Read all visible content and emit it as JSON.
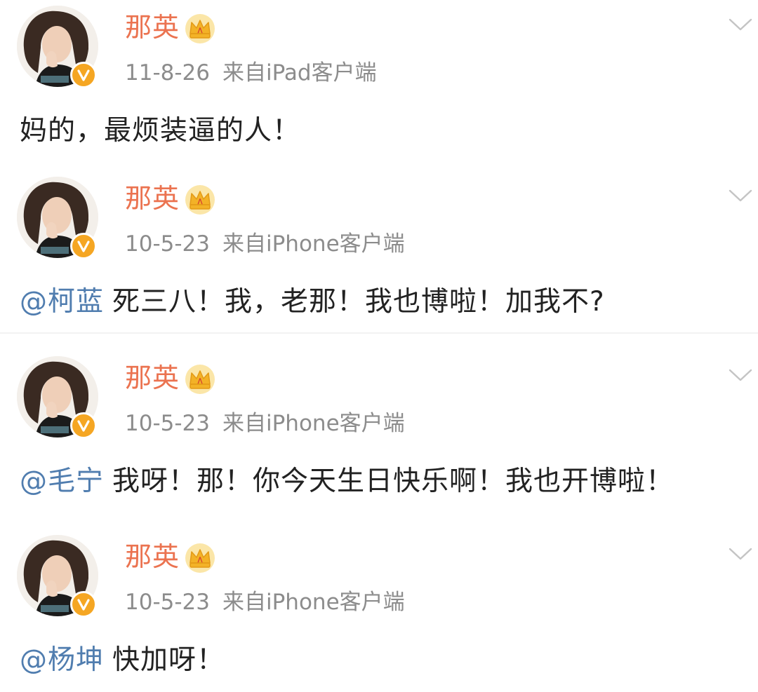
{
  "posts": [
    {
      "username": "那英",
      "time": "11-8-26",
      "source": "来自iPad客户端",
      "mention": "",
      "text": "妈的，最烦装逼的人！"
    },
    {
      "username": "那英",
      "time": "10-5-23",
      "source": "来自iPhone客户端",
      "mention": "@柯蓝",
      "text": "死三八！我，老那！我也博啦！加我不?"
    },
    {
      "username": "那英",
      "time": "10-5-23",
      "source": "来自iPhone客户端",
      "mention": "@毛宁",
      "text": "我呀！那！你今天生日快乐啊！我也开博啦！"
    },
    {
      "username": "那英",
      "time": "10-5-23",
      "source": "来自iPhone客户端",
      "mention": "@杨坤",
      "text": "快加呀！"
    }
  ],
  "icons": {
    "avatar": "avatar-photo",
    "verified": "verified-v-icon",
    "member": "crown-icon",
    "menu": "chevron-down-icon"
  },
  "colors": {
    "username": "#eb7350",
    "mention": "#507daf",
    "meta": "#8c8c8c",
    "text": "#222222",
    "verified_badge": "#f5a623",
    "crown": "#f3b227"
  }
}
